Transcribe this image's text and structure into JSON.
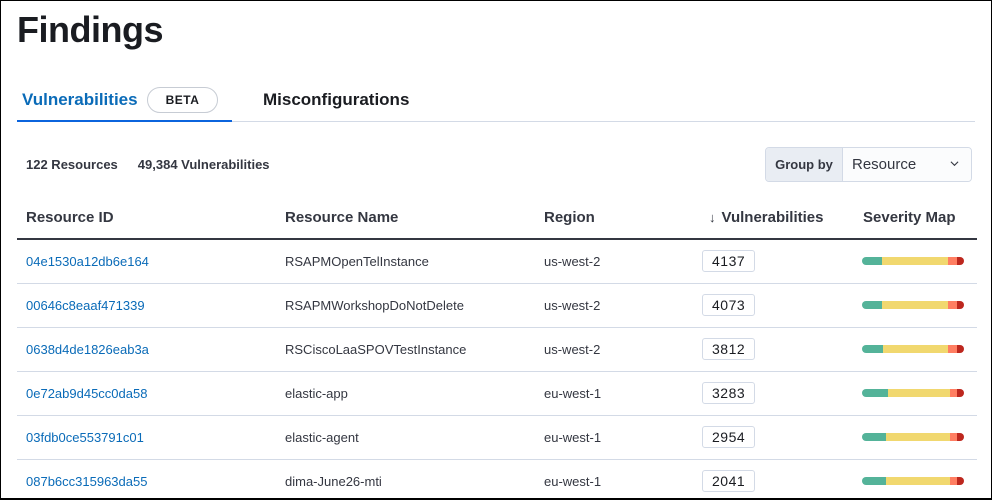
{
  "page": {
    "title": "Findings"
  },
  "tabs": [
    {
      "label": "Vulnerabilities",
      "badge": "BETA",
      "active": true
    },
    {
      "label": "Misconfigurations",
      "active": false
    }
  ],
  "summary": {
    "resources": "122 Resources",
    "vulnerabilities": "49,384 Vulnerabilities"
  },
  "group_by": {
    "label": "Group by",
    "selected": "Resource"
  },
  "table": {
    "headers": {
      "resource_id": "Resource ID",
      "resource_name": "Resource Name",
      "region": "Region",
      "vulnerabilities": "Vulnerabilities",
      "severity_map": "Severity Map"
    },
    "sort": {
      "column": "vulnerabilities",
      "direction": "desc",
      "icon": "arrow-down-icon"
    },
    "severity_colors": {
      "low": "#54b399",
      "medium": "#f1d86f",
      "high": "#ff7e62",
      "critical": "#bd271e"
    },
    "rows": [
      {
        "resource_id": "04e1530a12db6e164",
        "resource_name": "RSAPMOpenTelInstance",
        "region": "us-west-2",
        "vulnerabilities": "4137",
        "severity": {
          "low": 0.2,
          "medium": 0.64,
          "high": 0.09,
          "critical": 0.07
        }
      },
      {
        "resource_id": "00646c8eaaf471339",
        "resource_name": "RSAPMWorkshopDoNotDelete",
        "region": "us-west-2",
        "vulnerabilities": "4073",
        "severity": {
          "low": 0.2,
          "medium": 0.64,
          "high": 0.09,
          "critical": 0.07
        }
      },
      {
        "resource_id": "0638d4de1826eab3a",
        "resource_name": "RSCiscoLaaSPOVTestInstance",
        "region": "us-west-2",
        "vulnerabilities": "3812",
        "severity": {
          "low": 0.21,
          "medium": 0.63,
          "high": 0.09,
          "critical": 0.07
        }
      },
      {
        "resource_id": "0e72ab9d45cc0da58",
        "resource_name": "elastic-app",
        "region": "eu-west-1",
        "vulnerabilities": "3283",
        "severity": {
          "low": 0.25,
          "medium": 0.61,
          "high": 0.07,
          "critical": 0.07
        }
      },
      {
        "resource_id": "03fdb0ce553791c01",
        "resource_name": "elastic-agent",
        "region": "eu-west-1",
        "vulnerabilities": "2954",
        "severity": {
          "low": 0.24,
          "medium": 0.62,
          "high": 0.07,
          "critical": 0.07
        }
      },
      {
        "resource_id": "087b6cc315963da55",
        "resource_name": "dima-June26-mti",
        "region": "eu-west-1",
        "vulnerabilities": "2041",
        "severity": {
          "low": 0.24,
          "medium": 0.62,
          "high": 0.07,
          "critical": 0.07
        }
      }
    ]
  }
}
